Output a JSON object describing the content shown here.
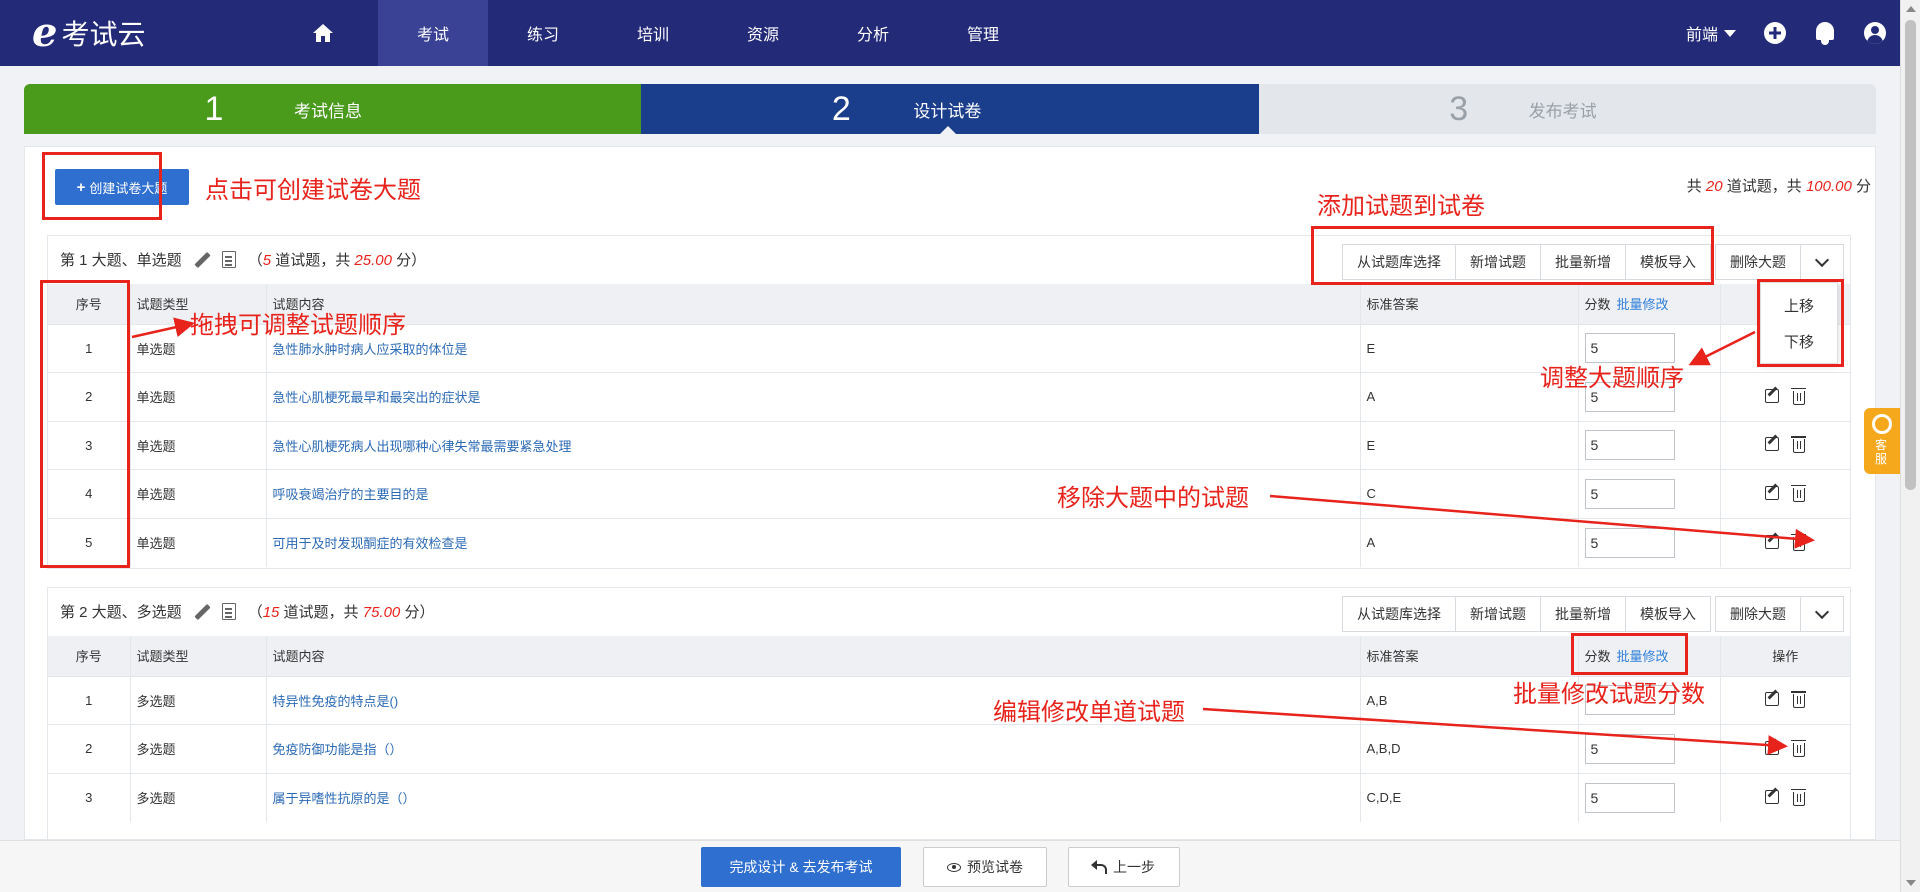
{
  "nav": {
    "logo": "考试云",
    "items": [
      "考试",
      "练习",
      "培训",
      "资源",
      "分析",
      "管理"
    ],
    "user": "前端"
  },
  "steps": [
    {
      "num": "1",
      "label": "考试信息"
    },
    {
      "num": "2",
      "label": "设计试卷"
    },
    {
      "num": "3",
      "label": "发布考试"
    }
  ],
  "header": {
    "create_label": "创建试卷大题",
    "total_prefix": "共 ",
    "total_count": "20",
    "total_mid": " 道试题，共 ",
    "total_score": "100.00",
    "total_suffix": " 分"
  },
  "sections": [
    {
      "title": "第 1 大题、单选题",
      "count": "5",
      "score": "25.00",
      "buttons": [
        "从试题库选择",
        "新增试题",
        "批量新增",
        "模板导入"
      ],
      "delete_label": "删除大题",
      "rows": [
        {
          "no": "1",
          "type": "单选题",
          "content": "急性肺水肿时病人应采取的体位是",
          "answer": "E",
          "score": "5"
        },
        {
          "no": "2",
          "type": "单选题",
          "content": "急性心肌梗死最早和最突出的症状是",
          "answer": "A",
          "score": "5"
        },
        {
          "no": "3",
          "type": "单选题",
          "content": "急性心肌梗死病人出现哪种心律失常最需要紧急处理",
          "answer": "E",
          "score": "5"
        },
        {
          "no": "4",
          "type": "单选题",
          "content": "呼吸衰竭治疗的主要目的是",
          "answer": "C",
          "score": "5"
        },
        {
          "no": "5",
          "type": "单选题",
          "content": "可用于及时发现酮症的有效检查是",
          "answer": "A",
          "score": "5"
        }
      ]
    },
    {
      "title": "第 2 大题、多选题",
      "count": "15",
      "score": "75.00",
      "buttons": [
        "从试题库选择",
        "新增试题",
        "批量新增",
        "模板导入"
      ],
      "delete_label": "删除大题",
      "rows": [
        {
          "no": "1",
          "type": "多选题",
          "content": "特异性免疫的特点是()",
          "answer": "A,B",
          "score": ""
        },
        {
          "no": "2",
          "type": "多选题",
          "content": "免疫防御功能是指（）",
          "answer": "A,B,D",
          "score": "5"
        },
        {
          "no": "3",
          "type": "多选题",
          "content": "属于异嗜性抗原的是（）",
          "answer": "C,D,E",
          "score": "5"
        }
      ]
    }
  ],
  "table_headers": {
    "no": "序号",
    "type": "试题类型",
    "content": "试题内容",
    "answer": "标准答案",
    "score": "分数",
    "batch": "批量修改",
    "ops": "操作"
  },
  "count_text": {
    "open": "（",
    "mid": " 道试题，共 ",
    "close": " 分）"
  },
  "dropdown": {
    "up": "上移",
    "down": "下移"
  },
  "side_tab": "客服",
  "bottom": {
    "finish": "完成设计 & 去发布考试",
    "preview": "预览试卷",
    "back": "上一步"
  },
  "annotations": {
    "create": "点击可创建试卷大题",
    "add": "添加试题到试卷",
    "drag": "拖拽可调整试题顺序",
    "reorder": "调整大题顺序",
    "remove": "移除大题中的试题",
    "batch": "批量修改试题分数",
    "edit": "编辑修改单道试题"
  },
  "colors": {
    "nav_bg": "#232a78",
    "step_done": "#4a9a1c",
    "step_active": "#1a3e8c",
    "primary": "#2f6fcf",
    "annotation": "#e8231c"
  }
}
